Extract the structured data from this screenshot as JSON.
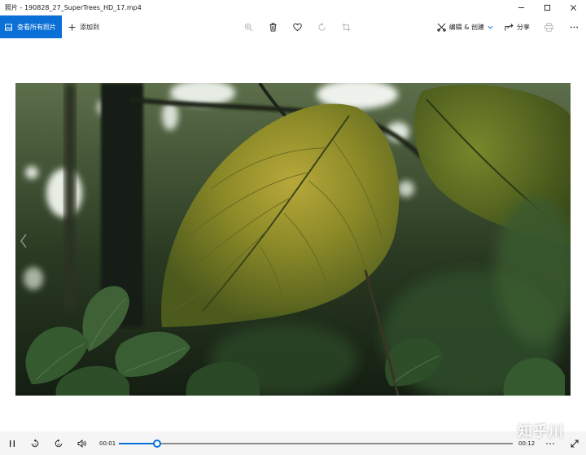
{
  "window": {
    "title": "照片 - 190828_27_SuperTrees_HD_17.mp4"
  },
  "toolbar": {
    "view_all_label": "查看所有照片",
    "add_to_label": "添加到",
    "edit_create_label": "编辑 & 创建",
    "share_label": "分享"
  },
  "player": {
    "current_time": "00:01",
    "total_time": "00:12",
    "progress": 0.098
  },
  "watermark": {
    "text": "知乎川"
  },
  "colors": {
    "accent": "#0a6fd6",
    "controls_bg": "#f5f5f5"
  },
  "icons": {
    "zoom": "zoom-icon",
    "delete": "trash-icon",
    "favorite": "heart-icon",
    "rotate": "rotate-icon",
    "crop": "crop-icon",
    "print": "printer-icon",
    "more": "more-icon"
  }
}
